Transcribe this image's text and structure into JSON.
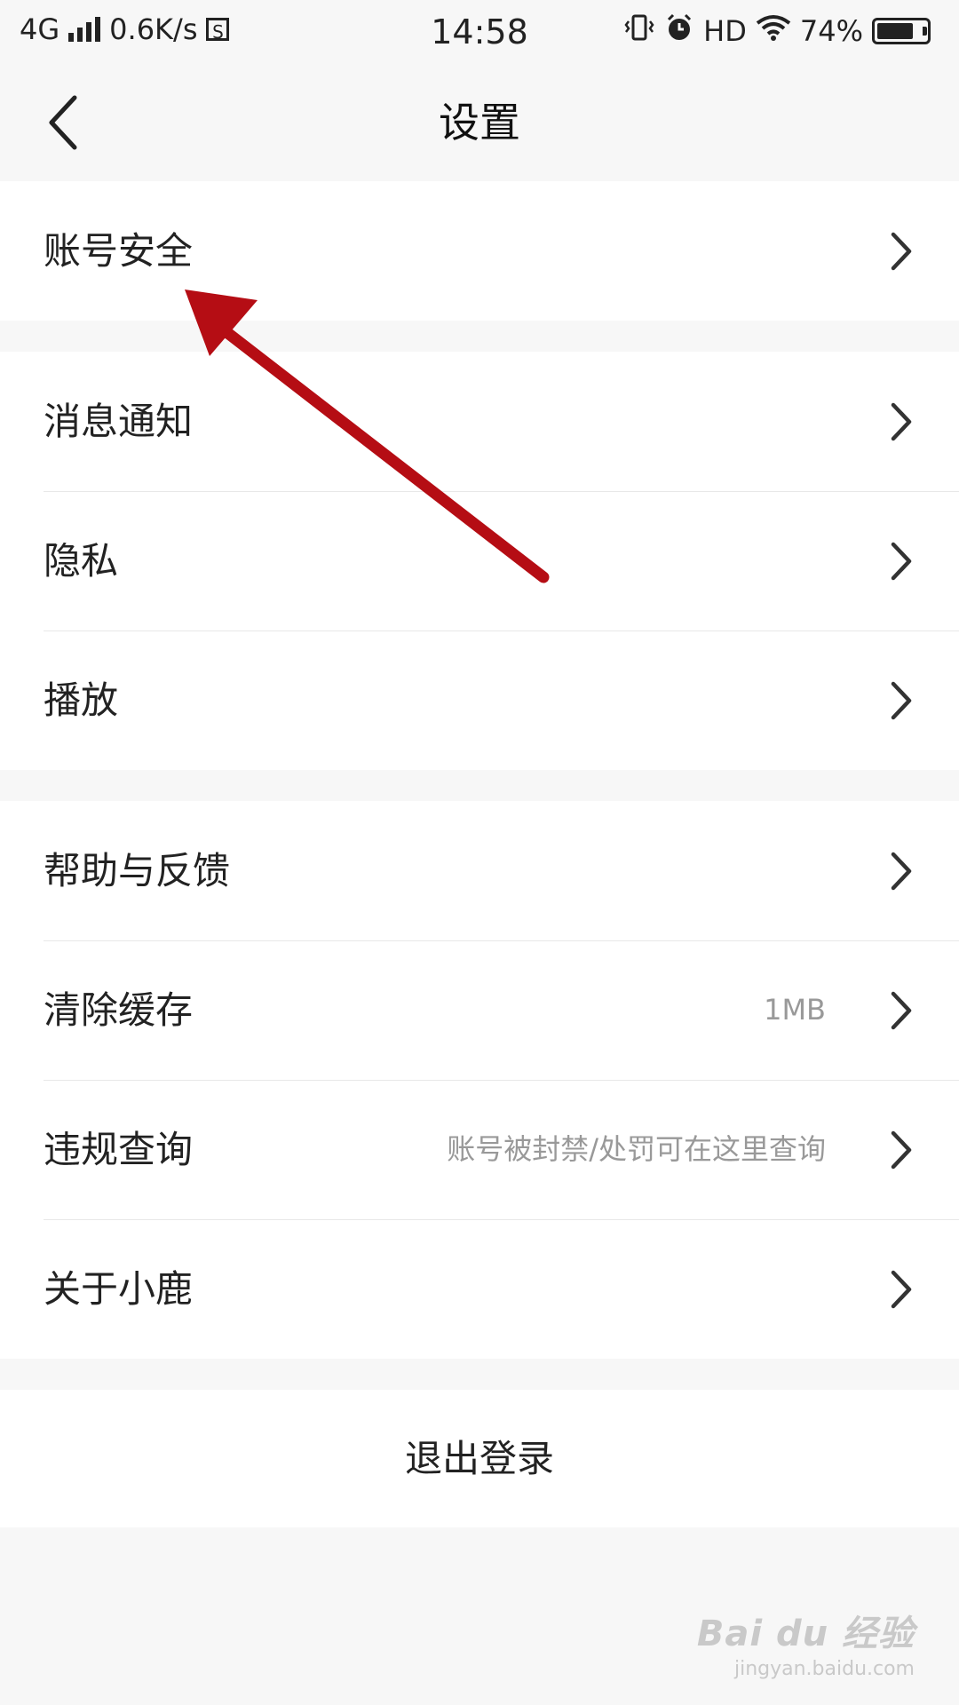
{
  "status_bar": {
    "network": "4G",
    "speed": "0.6K/s",
    "s_icon": "S",
    "time": "14:58",
    "hd": "HD",
    "battery_pct": "74%",
    "battery_level": 0.74
  },
  "header": {
    "title": "设置"
  },
  "groups": {
    "account": [
      {
        "label": "账号安全"
      }
    ],
    "general": [
      {
        "label": "消息通知"
      },
      {
        "label": "隐私"
      },
      {
        "label": "播放"
      }
    ],
    "more": [
      {
        "label": "帮助与反馈"
      },
      {
        "label": "清除缓存",
        "value": "1MB"
      },
      {
        "label": "违规查询",
        "value": "账号被封禁/处罚可在这里查询"
      },
      {
        "label": "关于小鹿"
      }
    ]
  },
  "logout": {
    "label": "退出登录"
  },
  "watermark": {
    "logo": "Bai du 经验",
    "url": "jingyan.baidu.com"
  },
  "colors": {
    "background": "#f7f7f7",
    "annotation_arrow": "#b50d14",
    "secondary_text": "#999999"
  },
  "icons": [
    "back-arrow-icon",
    "chevron-right-icon",
    "signal-icon",
    "wifi-icon",
    "vibrate-icon",
    "alarm-icon",
    "battery-icon"
  ]
}
